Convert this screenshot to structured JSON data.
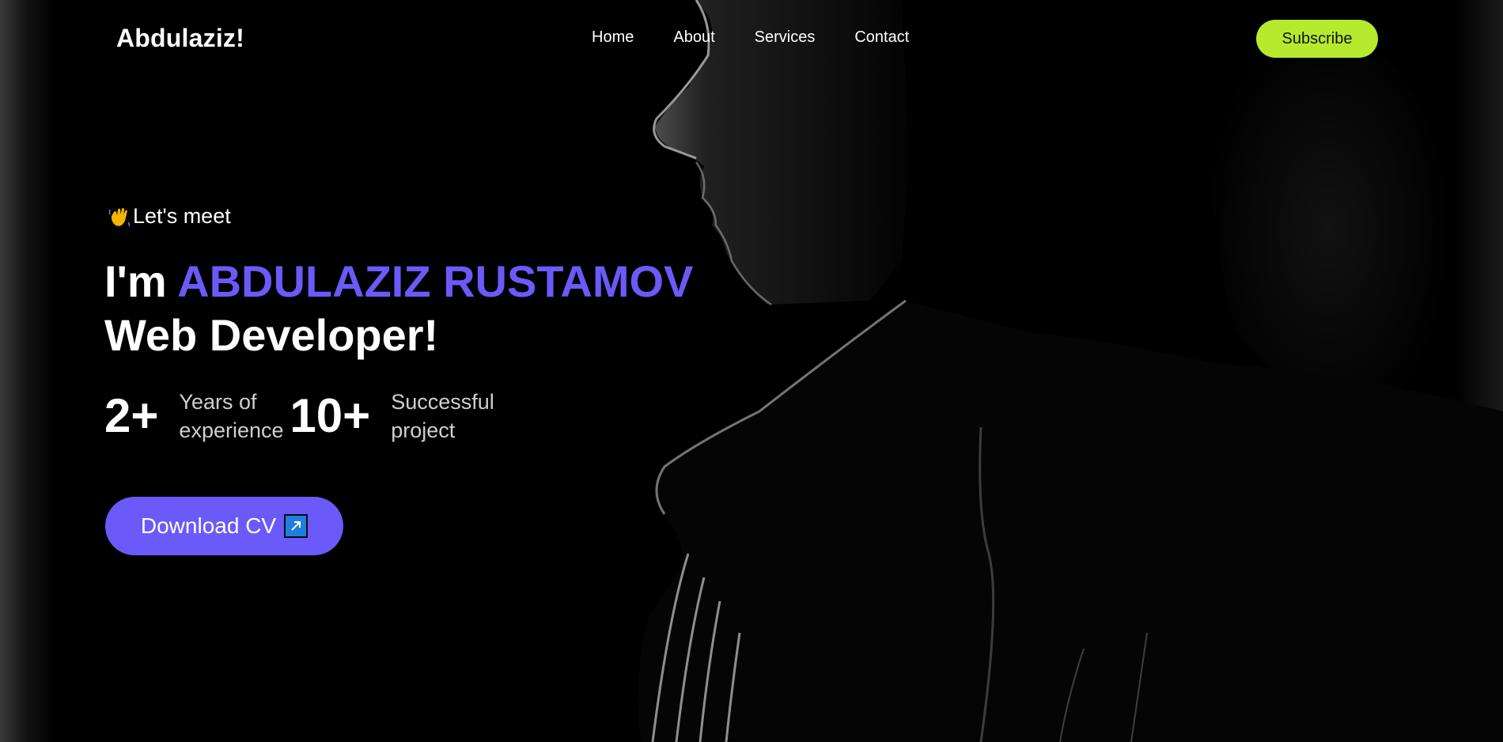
{
  "navbar": {
    "logo": "Abdulaziz!",
    "links": [
      "Home",
      "About",
      "Services",
      "Contact"
    ],
    "subscribe_label": "Subscribe"
  },
  "hero": {
    "greeting_icon": "waving-hand-icon",
    "greeting": "Let's meet",
    "headline_prefix": "I'm ",
    "headline_name": "ABDULAZIZ RUSTAMOV",
    "headline_role": "Web Developer!",
    "stats": [
      {
        "value": "2+",
        "label": "Years of experience"
      },
      {
        "value": "10+",
        "label": "Successful project"
      }
    ],
    "download_label": "Download CV",
    "download_icon": "arrow-up-right-icon"
  },
  "colors": {
    "accent": "#6a5af9",
    "subscribe": "#b5ea2e",
    "background": "#000000",
    "text": "#ffffff"
  }
}
